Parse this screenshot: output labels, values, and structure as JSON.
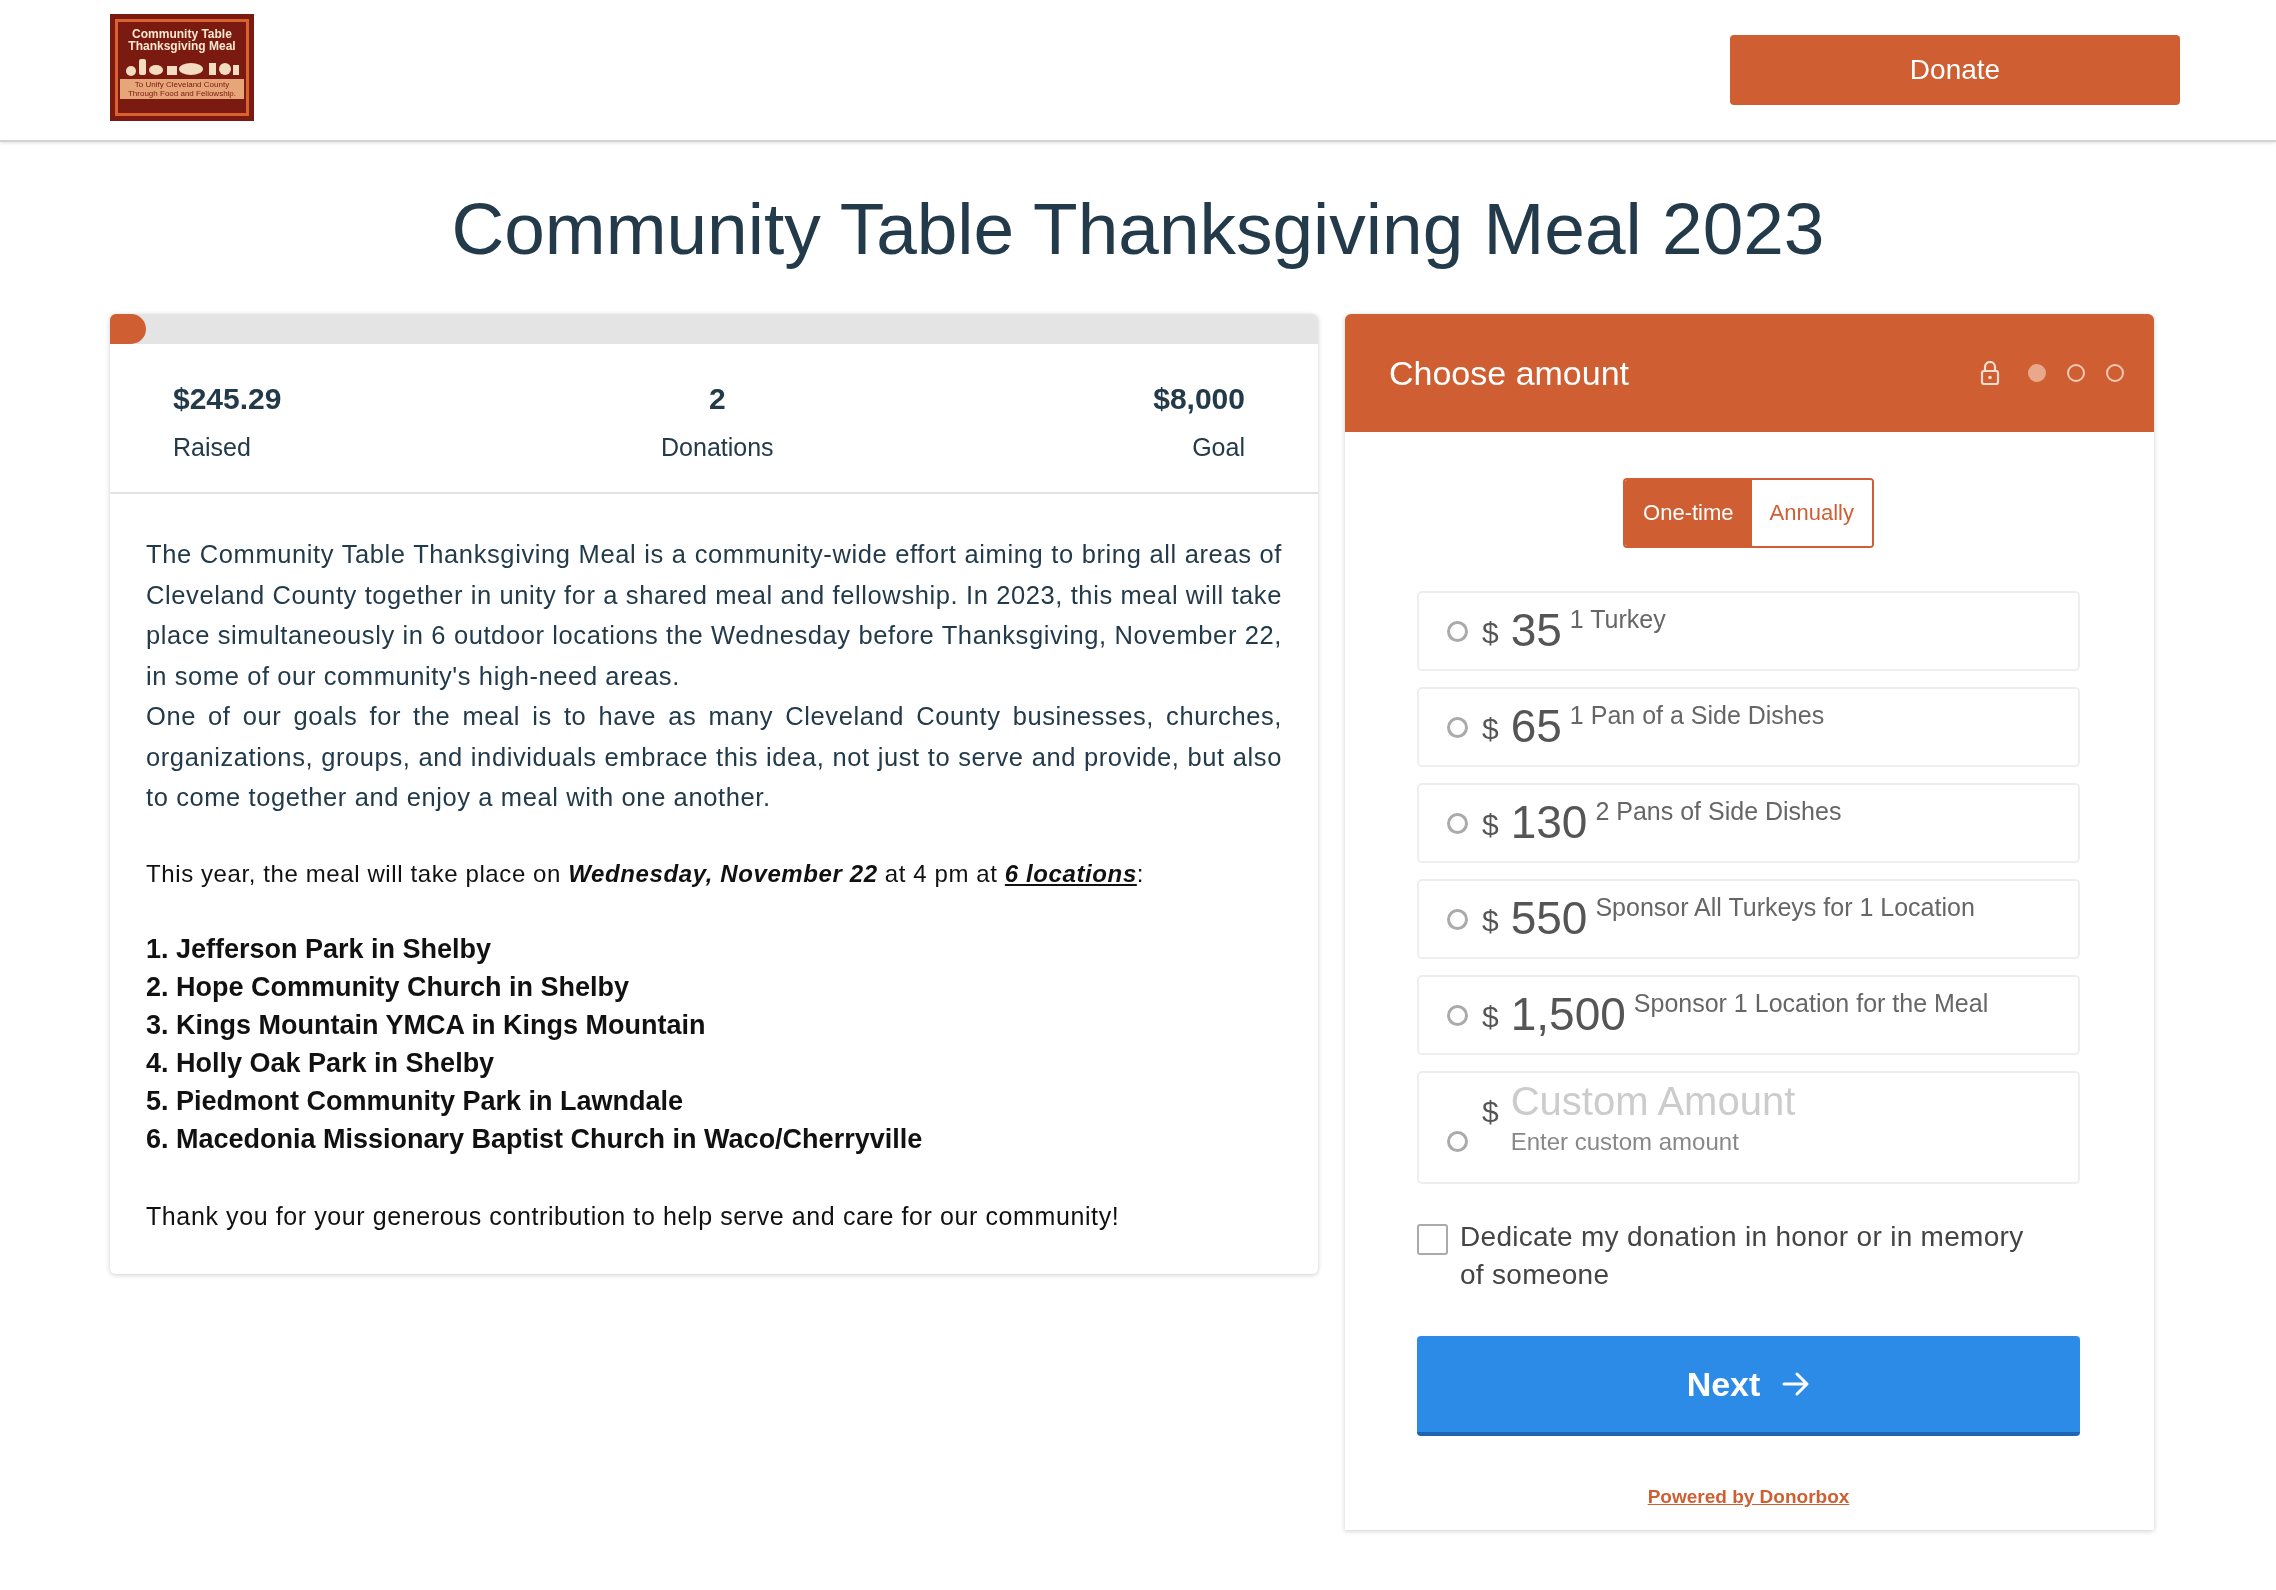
{
  "header": {
    "logo": {
      "title": "Community Table Thanksgiving Meal",
      "tagline": "To Unify Cleveland County Through Food and Fellowship."
    },
    "donate_button": "Donate"
  },
  "page_title": "Community Table Thanksgiving Meal 2023",
  "campaign": {
    "progress": {
      "level": 0.03
    },
    "stats": [
      {
        "value": "$245.29",
        "label": "Raised"
      },
      {
        "value": "2",
        "label": "Donations"
      },
      {
        "value": "$8,000",
        "label": "Goal"
      }
    ],
    "paragraphs": [
      "The Community Table Thanksgiving Meal is a community-wide effort aiming to bring all areas of Cleveland County together in unity for a shared meal and fellowship. In 2023, this meal will take place simultaneously in 6 outdoor locations the Wednesday before Thanksgiving, November 22, in some of our community's high-need areas.",
      "One of our goals for the meal is to have as many Cleveland County businesses, churches, organizations, groups, and individuals embrace this idea, not just to serve and provide, but also to come together and enjoy a meal with one another."
    ],
    "schedule": {
      "text": "This year, the meal will take place on **Wednesday, November 22** at 4 pm at",
      "link": "6 locations",
      "after": ":"
    },
    "locations": [
      "1. Jefferson Park in Shelby",
      "2. Hope Community Church in Shelby",
      "3. Kings Mountain YMCA in Kings Mountain",
      "4. Holly Oak Park in Shelby",
      "5. Piedmont Community Park in Lawndale",
      "6. Macedonia Missionary Baptist Church in Waco/Cherryville"
    ],
    "thanks": "Thank you for your generous contribution to help serve and care for our community!"
  },
  "form": {
    "title": "Choose amount",
    "steps": [
      {
        "selected": true
      },
      {
        "selected": false
      },
      {
        "selected": false
      }
    ],
    "frequency": [
      {
        "label": "One-time",
        "selected": true
      },
      {
        "label": "Annually",
        "selected": false
      }
    ],
    "amounts": [
      {
        "currency": "$",
        "amount": "35",
        "description": "1 Turkey",
        "selected": false
      },
      {
        "currency": "$",
        "amount": "65",
        "description": "1 Pan of a Side Dishes",
        "selected": false
      },
      {
        "currency": "$",
        "amount": "130",
        "description": "2 Pans of Side Dishes",
        "selected": false
      },
      {
        "currency": "$",
        "amount": "550",
        "description": "Sponsor All Turkeys for 1 Location",
        "selected": false
      },
      {
        "currency": "$",
        "amount": "1,500",
        "description": "Sponsor 1 Location for the Meal",
        "selected": false
      }
    ],
    "custom": {
      "currency": "$",
      "placeholder": "Custom Amount",
      "hint": "Enter custom amount",
      "selected": false
    },
    "dedicate": {
      "label": "Dedicate my donation in honor or in memory of someone",
      "checked": false
    },
    "next_button": "Next",
    "footer_link": "Powered by Donorbox"
  }
}
